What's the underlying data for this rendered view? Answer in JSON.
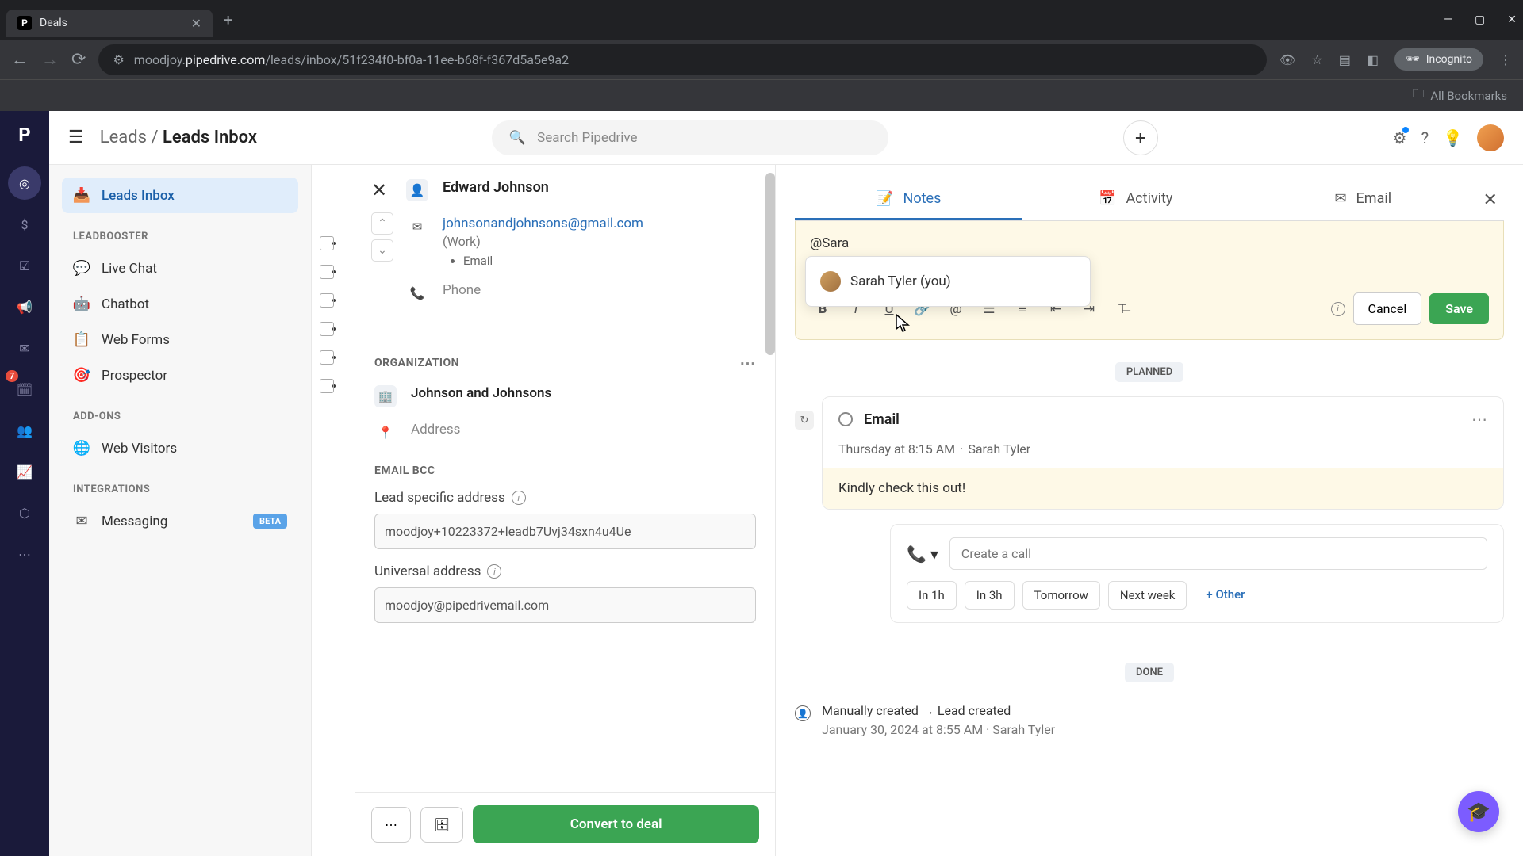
{
  "browser": {
    "tab_title": "Deals",
    "url_prefix": "moodjoy.",
    "url_domain": "pipedrive.com",
    "url_path": "/leads/inbox/51f234f0-bf0a-11ee-b68f-f367d5a5e9a2",
    "incognito": "Incognito",
    "bookmarks": "All Bookmarks"
  },
  "header": {
    "breadcrumb_parent": "Leads",
    "breadcrumb_current": "Leads Inbox",
    "search_placeholder": "Search Pipedrive"
  },
  "sidebar": {
    "inbox": "Leads Inbox",
    "section_leadbooster": "LEADBOOSTER",
    "live_chat": "Live Chat",
    "chatbot": "Chatbot",
    "web_forms": "Web Forms",
    "prospector": "Prospector",
    "section_addons": "ADD-ONS",
    "web_visitors": "Web Visitors",
    "section_integrations": "INTEGRATIONS",
    "messaging": "Messaging",
    "beta": "BETA"
  },
  "rail": {
    "badge_count": "7"
  },
  "detail": {
    "person_name": "Edward Johnson",
    "email": "johnsonandjohnsons@gmail.com",
    "email_label": "(Work)",
    "email_type": "Email",
    "phone_label": "Phone",
    "org_section": "ORGANIZATION",
    "org_name": "Johnson and Johnsons",
    "address_label": "Address",
    "bcc_section": "EMAIL BCC",
    "lead_address_label": "Lead specific address",
    "lead_address_value": "moodjoy+10223372+leadb7Uvj34sxn4u4Ue",
    "universal_label": "Universal address",
    "universal_value": "moodjoy@pipedrivemail.com",
    "convert": "Convert to deal"
  },
  "notes": {
    "tab_notes": "Notes",
    "tab_activity": "Activity",
    "tab_email": "Email",
    "mention_text": "@Sara",
    "mention_option": "Sarah Tyler (you)",
    "cancel": "Cancel",
    "save": "Save"
  },
  "activity": {
    "planned_label": "PLANNED",
    "done_label": "DONE",
    "card_title": "Email",
    "card_time": "Thursday at 8:15 AM",
    "card_author": "Sarah Tyler",
    "card_body": "Kindly check this out!",
    "call_placeholder": "Create a call",
    "chip_1h": "In 1h",
    "chip_3h": "In 3h",
    "chip_tomorrow": "Tomorrow",
    "chip_nextweek": "Next week",
    "chip_other": "+ Other",
    "log_text": "Manually created → Lead created",
    "log_time": "January 30, 2024 at 8:55 AM",
    "log_author": "Sarah Tyler"
  }
}
